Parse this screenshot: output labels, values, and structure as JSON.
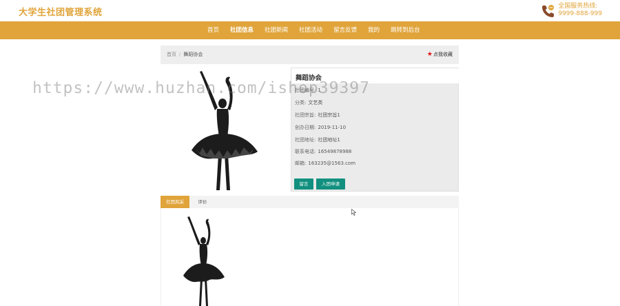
{
  "header": {
    "brand": "大学生社团管理系统",
    "hotline_label": "全国服务热线:",
    "hotline_number": "9999-888-999"
  },
  "nav": {
    "items": [
      {
        "label": "首页",
        "active": false
      },
      {
        "label": "社团信息",
        "active": true
      },
      {
        "label": "社团新闻",
        "active": false
      },
      {
        "label": "社团活动",
        "active": false
      },
      {
        "label": "留言反馈",
        "active": false
      },
      {
        "label": "我的",
        "active": false
      },
      {
        "label": "跳转到后台",
        "active": false
      }
    ]
  },
  "breadcrumb": {
    "home": "首页",
    "separator": "/",
    "current": "舞蹈协会",
    "favorite_label": "点我收藏"
  },
  "club": {
    "title": "舞蹈协会",
    "fields": [
      {
        "label": "社团编号:",
        "value": "1"
      },
      {
        "label": "分类:",
        "value": "文艺类"
      },
      {
        "label": "社团宗旨:",
        "value": "社团宗旨1"
      },
      {
        "label": "创办日期:",
        "value": "2019-11-10"
      },
      {
        "label": "社团地址:",
        "value": "社团地址1"
      },
      {
        "label": "联系电话:",
        "value": "16549878988"
      },
      {
        "label": "邮箱:",
        "value": "163235@1563.com"
      }
    ],
    "btn_message": "留言",
    "btn_apply": "入团申请"
  },
  "tabs": {
    "items": [
      {
        "label": "社团风采",
        "active": true
      },
      {
        "label": "评价",
        "active": false
      }
    ]
  },
  "watermark": "https://www.huzhan.com/ishop39397",
  "colors": {
    "accent": "#e0a43a",
    "button": "#12907f",
    "favorite_star": "#e01010"
  }
}
